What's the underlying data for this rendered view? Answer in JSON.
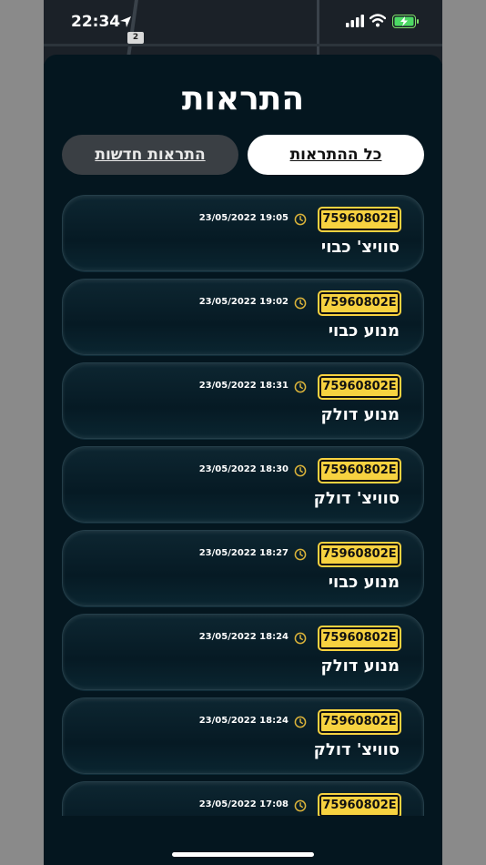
{
  "status_bar": {
    "time": "22:34"
  },
  "map": {
    "route_shield": "2"
  },
  "page": {
    "title": "התראות",
    "tabs": [
      {
        "label": "כל ההתראות",
        "active": true
      },
      {
        "label": "התראות חדשות",
        "active": false
      }
    ]
  },
  "notifications": [
    {
      "plate": "75960802E",
      "timestamp": "23/05/2022 19:05",
      "message": "סוויצ' כבוי"
    },
    {
      "plate": "75960802E",
      "timestamp": "23/05/2022 19:02",
      "message": "מנוע כבוי"
    },
    {
      "plate": "75960802E",
      "timestamp": "23/05/2022 18:31",
      "message": "מנוע דולק"
    },
    {
      "plate": "75960802E",
      "timestamp": "23/05/2022 18:30",
      "message": "סוויצ' דולק"
    },
    {
      "plate": "75960802E",
      "timestamp": "23/05/2022 18:27",
      "message": "מנוע כבוי"
    },
    {
      "plate": "75960802E",
      "timestamp": "23/05/2022 18:24",
      "message": "מנוע דולק"
    },
    {
      "plate": "75960802E",
      "timestamp": "23/05/2022 18:24",
      "message": "סוויצ' דולק"
    },
    {
      "plate": "75960802E",
      "timestamp": "23/05/2022 17:08",
      "message": ""
    }
  ],
  "colors": {
    "background": "#04161f",
    "plate_yellow": "#f7d240",
    "clock_icon": "#d9b23a",
    "tab_active_bg": "#ffffff",
    "tab_inactive_bg": "#3a3f44"
  },
  "icons": {
    "location": "location-arrow-icon",
    "signal": "cellular-signal-icon",
    "wifi": "wifi-icon",
    "battery": "battery-charging-icon",
    "clock": "clock-icon"
  }
}
